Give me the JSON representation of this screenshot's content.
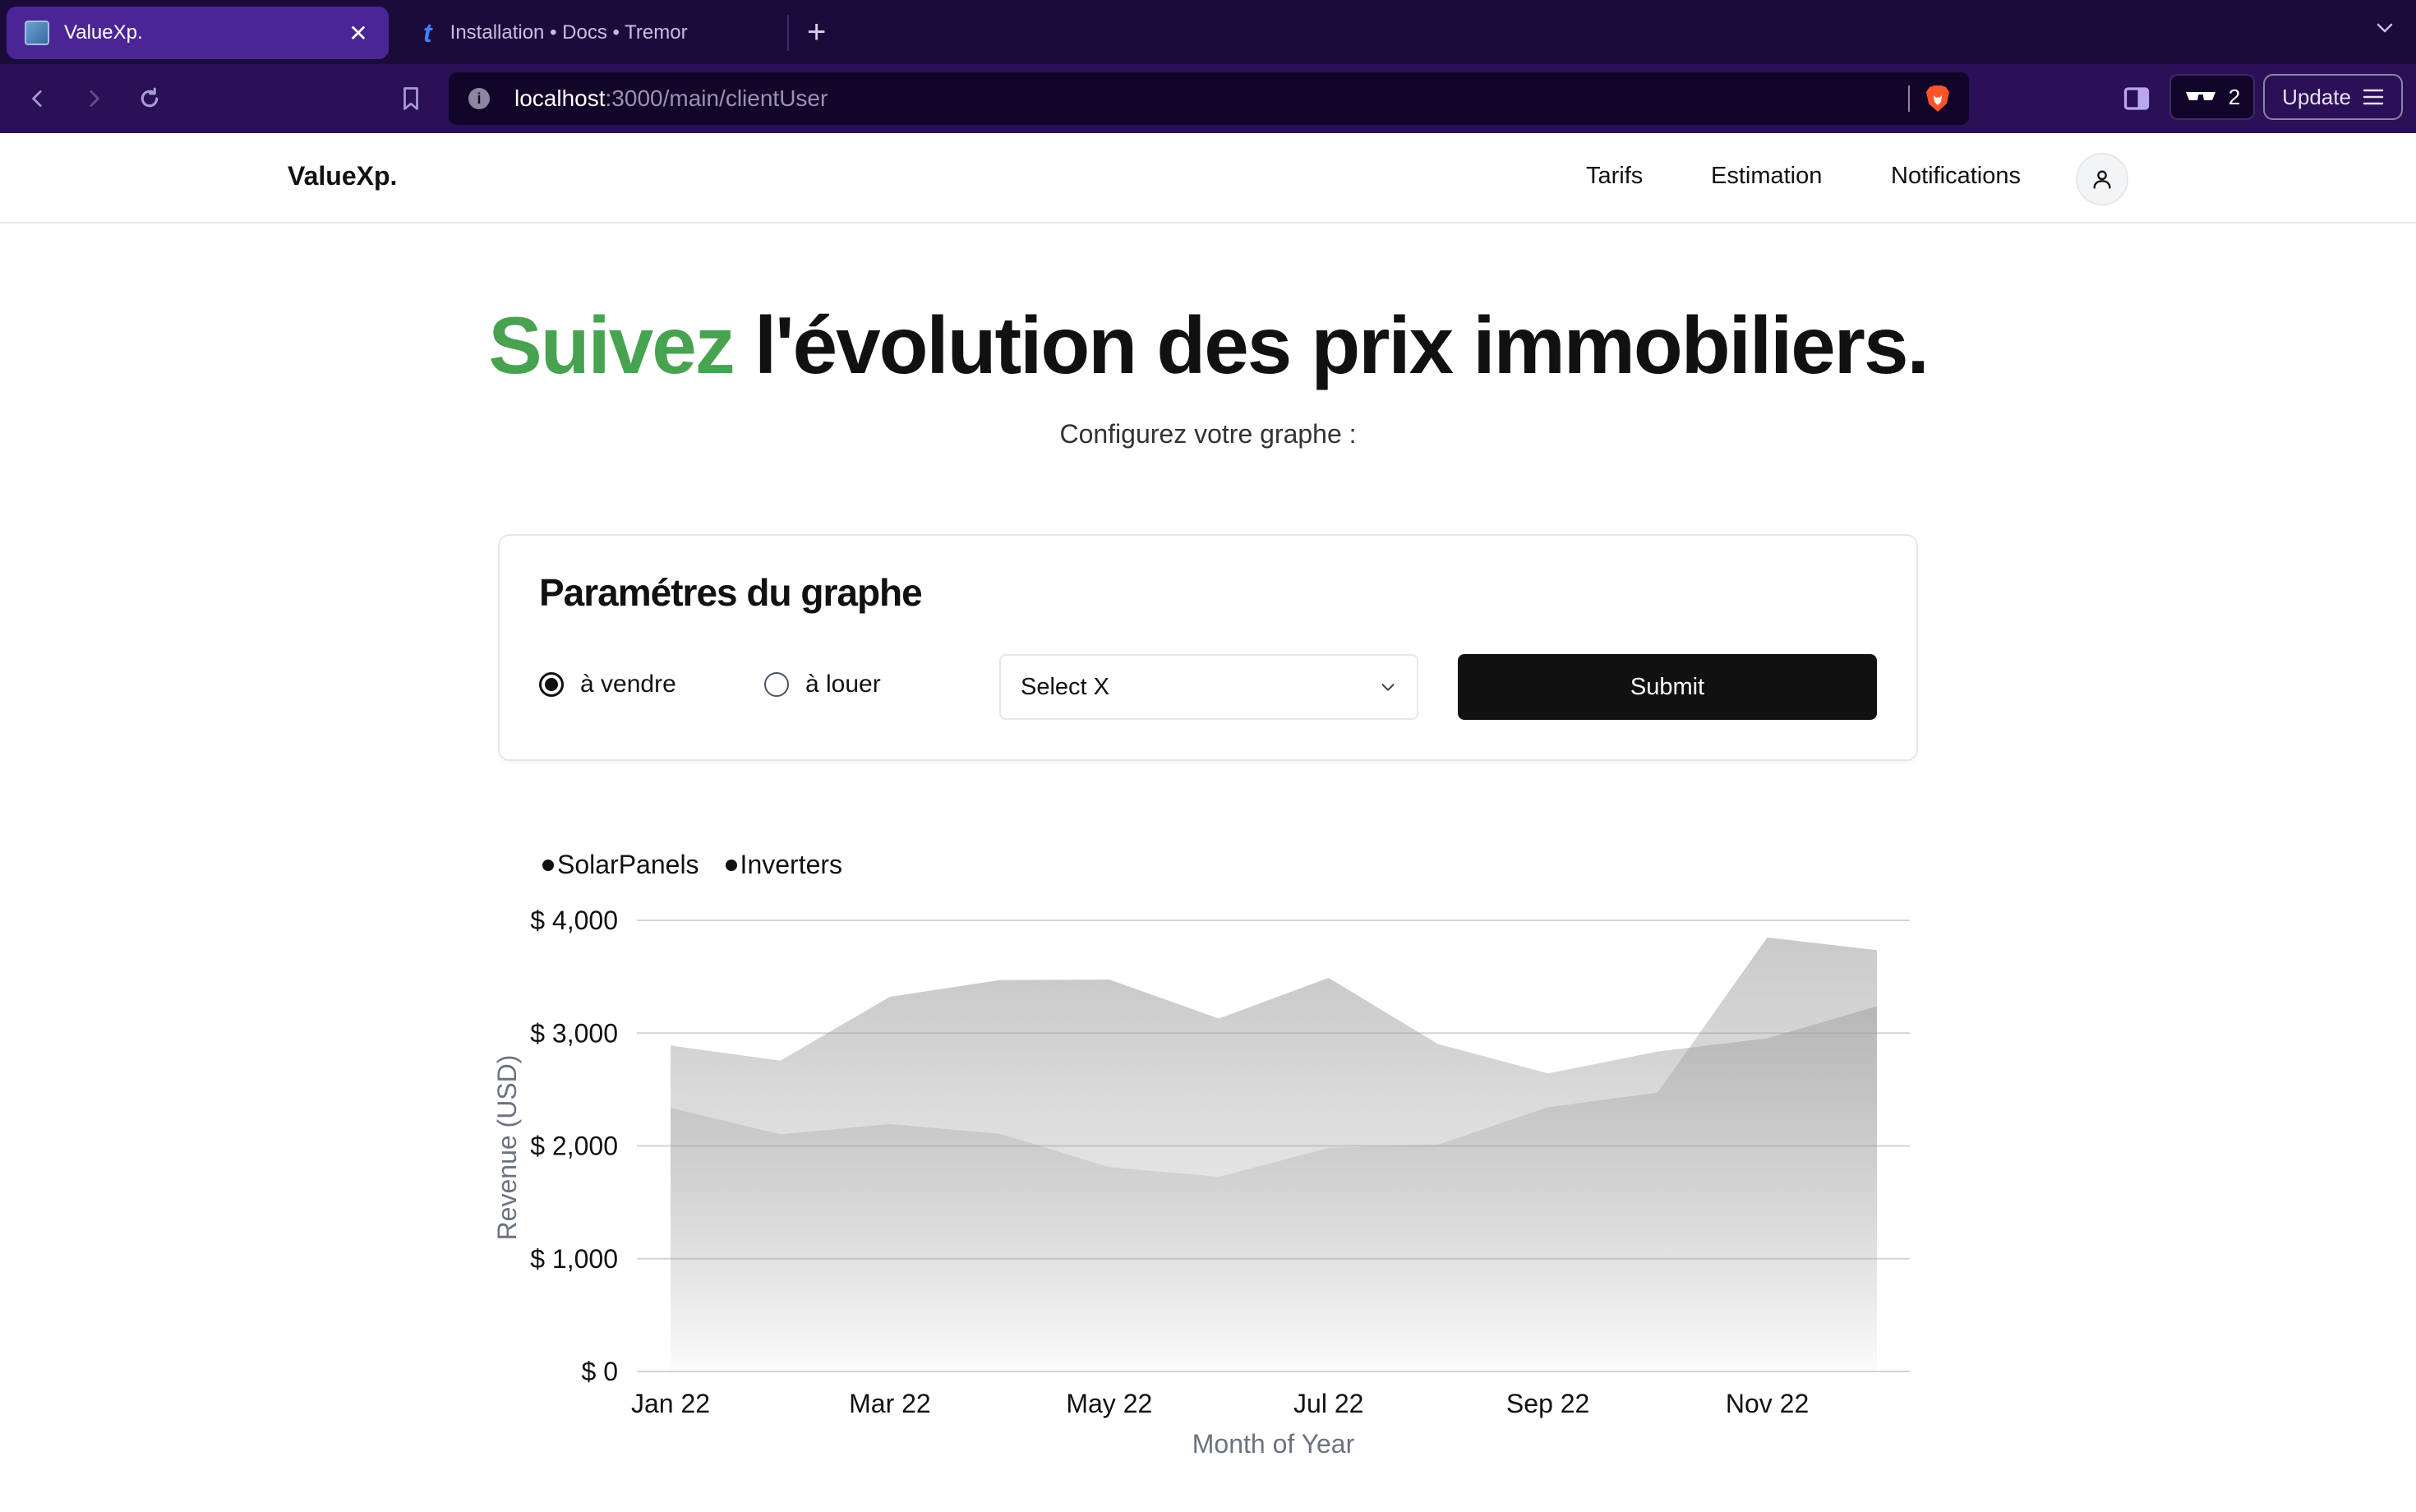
{
  "browser": {
    "tabs": [
      {
        "label": "ValueXp.",
        "active": true
      },
      {
        "label": "Installation • Docs • Tremor",
        "active": false
      }
    ],
    "url": {
      "host": "localhost",
      "path": ":3000/main/clientUser"
    },
    "extension_count": "2",
    "update_label": "Update"
  },
  "header": {
    "brand": "ValueXp.",
    "nav": [
      "Tarifs",
      "Estimation",
      "Notifications"
    ]
  },
  "hero": {
    "title_accent": "Suivez",
    "title_rest": "l'évolution des prix immobiliers.",
    "subtitle": "Configurez votre graphe :"
  },
  "params": {
    "title": "Paramétres du graphe",
    "radio_sell": "à vendre",
    "radio_rent": "à louer",
    "selected_radio": "sell",
    "select_value": "Select X",
    "submit_label": "Submit"
  },
  "chart_data": {
    "type": "area",
    "x": [
      "Jan 22",
      "Feb 22",
      "Mar 22",
      "Apr 22",
      "May 22",
      "Jun 22",
      "Jul 22",
      "Aug 22",
      "Sep 22",
      "Oct 22",
      "Nov 22",
      "Dec 22"
    ],
    "x_tick_labels": [
      "Jan 22",
      "Mar 22",
      "May 22",
      "Jul 22",
      "Sep 22",
      "Nov 22"
    ],
    "series": [
      {
        "name": "SolarPanels",
        "values": [
          2890,
          2756,
          3322,
          3470,
          3475,
          3129,
          3490,
          2903,
          2643,
          2837,
          2954,
          3239
        ]
      },
      {
        "name": "Inverters",
        "values": [
          2338,
          2103,
          2194,
          2108,
          1812,
          1726,
          1982,
          2012,
          2342,
          2473,
          3848,
          3736
        ]
      }
    ],
    "ylim": [
      0,
      4000
    ],
    "y_ticks": [
      0,
      1000,
      2000,
      3000,
      4000
    ],
    "y_tick_labels": [
      "$ 0",
      "$ 1,000",
      "$ 2,000",
      "$ 3,000",
      "$ 4,000"
    ],
    "xlabel": "Month of Year",
    "ylabel": "Revenue (USD)",
    "grid": true,
    "legend": "top-left",
    "colors": {
      "area": "#9e9e9e",
      "grid": "#d1d5db",
      "axis": "#d1d5db",
      "text": "#111111",
      "label": "#6b7280"
    }
  },
  "colors": {
    "accent_green": "#47a34f",
    "tabbar_bg": "#1b0b3b",
    "toolbar_bg": "#2a1057",
    "active_tab_bg": "#4b2596",
    "button_dark": "#111111"
  }
}
